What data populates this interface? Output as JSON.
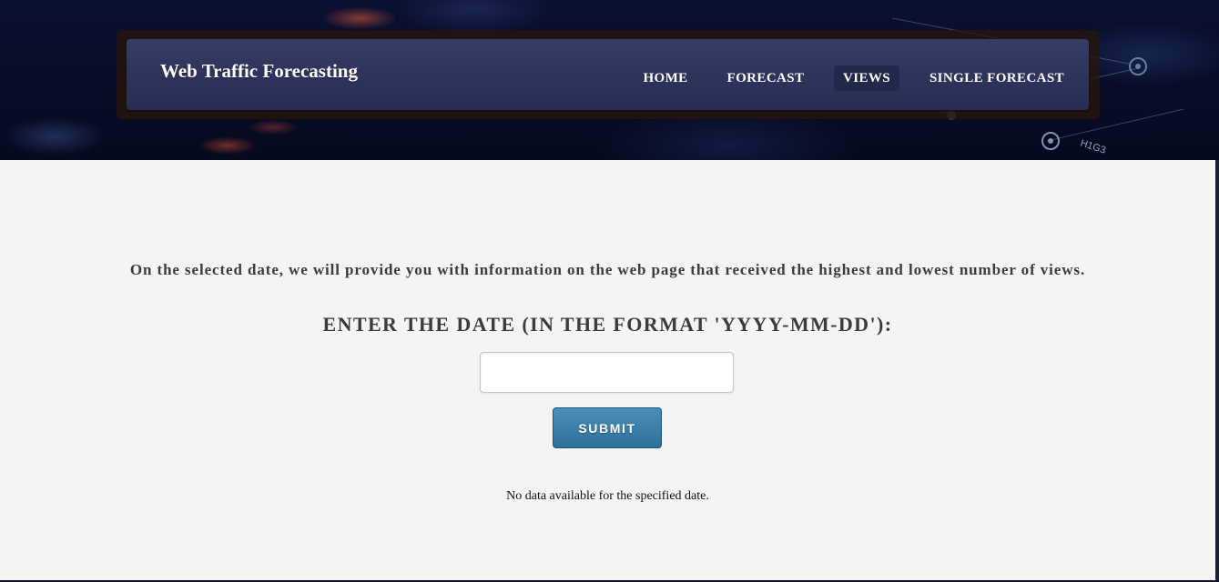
{
  "header": {
    "brand": "Web Traffic Forecasting",
    "nav": [
      {
        "label": "HOME",
        "active": false
      },
      {
        "label": "FORECAST",
        "active": false
      },
      {
        "label": "VIEWS",
        "active": true
      },
      {
        "label": "SINGLE FORECAST",
        "active": false
      }
    ],
    "background_text": "H1G3"
  },
  "main": {
    "intro": "On the selected date, we will provide you with information on the web page that received the highest and lowest number of views.",
    "prompt": "ENTER THE DATE (IN THE FORMAT 'YYYY-MM-DD'):",
    "date_input": {
      "value": "",
      "placeholder": ""
    },
    "submit_label": "SUBMIT",
    "result_message": "No data available for the specified date."
  },
  "colors": {
    "navbar": "#2d3358",
    "active_nav": "#22284a",
    "content_bg": "#f4f4f4",
    "button": "#3a7ca7",
    "text": "#3c3c3c"
  }
}
